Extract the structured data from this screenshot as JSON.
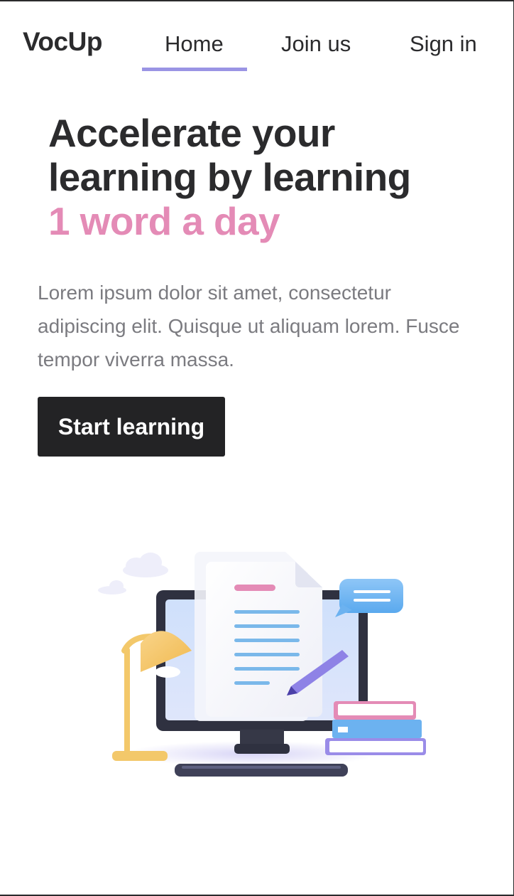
{
  "nav": {
    "brand": "VocUp",
    "home": "Home",
    "join": "Join us",
    "signin": "Sign in",
    "active": "Home"
  },
  "hero": {
    "title_line1": "Accelerate your",
    "title_line2": "learning by learning",
    "title_accent": "1 word a day",
    "description": "Lorem ipsum dolor sit amet, consectetur adipiscing elit. Quisque ut aliquam lorem. Fusce tempor viverra massa.",
    "cta_label": "Start learning"
  },
  "colors": {
    "accent_pink": "#e48bb6",
    "nav_underline": "#9a94e4",
    "button_bg": "#232325",
    "text_dark": "#2b2b2d",
    "text_muted": "#7b7b80"
  },
  "illustration": {
    "icons": [
      "cloud-icon",
      "desk-lamp-icon",
      "monitor-icon",
      "document-icon",
      "pencil-icon",
      "chat-bubble-icon",
      "books-icon",
      "keyboard-icon"
    ]
  }
}
